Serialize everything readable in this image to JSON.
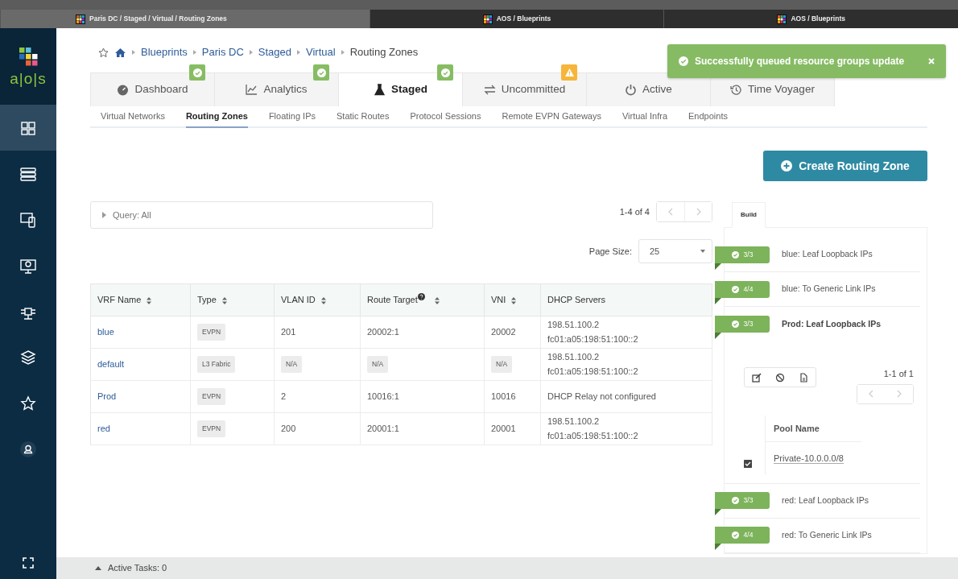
{
  "browser_tabs": [
    {
      "title": "Paris DC / Staged / Virtual / Routing Zones",
      "selected": true
    },
    {
      "title": "AOS / Blueprints",
      "selected": false
    },
    {
      "title": "AOS / Blueprints",
      "selected": false
    }
  ],
  "sidebar": {
    "logo": "a|o|s",
    "items": [
      {
        "kind": "blueprints",
        "selected": true
      },
      {
        "kind": "racks",
        "selected": false
      },
      {
        "kind": "devices",
        "selected": false
      },
      {
        "kind": "monitor",
        "selected": false
      },
      {
        "kind": "network",
        "selected": false
      },
      {
        "kind": "layers",
        "selected": false
      },
      {
        "kind": "star",
        "selected": false
      },
      {
        "kind": "user",
        "selected": false
      }
    ]
  },
  "breadcrumb": {
    "starred": false,
    "items": [
      "Blueprints",
      "Paris DC",
      "Staged",
      "Virtual",
      "Routing Zones"
    ]
  },
  "tabs": [
    {
      "label": "Dashboard",
      "kind": "gauge",
      "selected": false,
      "badge": {
        "kind": "ok"
      }
    },
    {
      "label": "Analytics",
      "kind": "chart",
      "selected": false,
      "badge": {
        "kind": "ok"
      }
    },
    {
      "label": "Staged",
      "kind": "flask",
      "selected": true,
      "badge": {
        "kind": "ok"
      }
    },
    {
      "label": "Uncommitted",
      "kind": "exchange",
      "selected": false,
      "badge": {
        "kind": "warning"
      }
    },
    {
      "label": "Active",
      "kind": "power",
      "selected": false
    },
    {
      "label": "Time Voyager",
      "kind": "history",
      "selected": false
    }
  ],
  "subtabs": [
    {
      "label": "Virtual Networks",
      "selected": false
    },
    {
      "label": "Routing Zones",
      "selected": true
    },
    {
      "label": "Floating IPs",
      "selected": false
    },
    {
      "label": "Static Routes",
      "selected": false
    },
    {
      "label": "Protocol Sessions",
      "selected": false
    },
    {
      "label": "Remote EVPN Gateways",
      "selected": false
    },
    {
      "label": "Virtual Infra",
      "selected": false
    },
    {
      "label": "Endpoints",
      "selected": false
    }
  ],
  "toast": {
    "kind": "success",
    "text": "Successfully queued resource groups update"
  },
  "create_button": "Create Routing Zone",
  "query": {
    "label": "Query: All"
  },
  "pagination": "1-4 of 4",
  "page_size": {
    "label": "Page Size:",
    "value": "25"
  },
  "table": {
    "columns": [
      {
        "label": "VRF Name",
        "sortable": true,
        "info": false
      },
      {
        "label": "Type",
        "sortable": true,
        "info": false
      },
      {
        "label": "VLAN ID",
        "sortable": true,
        "info": false
      },
      {
        "label": "Route Target",
        "sortable": true,
        "info": true
      },
      {
        "label": "VNI",
        "sortable": true,
        "info": false
      },
      {
        "label": "DHCP Servers",
        "sortable": false,
        "info": false
      }
    ],
    "rows": [
      {
        "cells": [
          {
            "kind": "link",
            "text": "blue"
          },
          {
            "kind": "tag",
            "text": "EVPN"
          },
          {
            "kind": "plain",
            "text": "201"
          },
          {
            "kind": "plain",
            "text": "20002:1"
          },
          {
            "kind": "plain",
            "text": "20002"
          },
          {
            "kind": "lines",
            "lines": [
              "198.51.100.2",
              "fc01:a05:198:51:100::2"
            ]
          }
        ]
      },
      {
        "cells": [
          {
            "kind": "link",
            "text": "default"
          },
          {
            "kind": "tag",
            "text": "L3 Fabric"
          },
          {
            "kind": "tag",
            "text": "N/A"
          },
          {
            "kind": "tag",
            "text": "N/A"
          },
          {
            "kind": "tag",
            "text": "N/A"
          },
          {
            "kind": "lines",
            "lines": [
              "198.51.100.2",
              "fc01:a05:198:51:100::2"
            ]
          }
        ]
      },
      {
        "cells": [
          {
            "kind": "link",
            "text": "Prod"
          },
          {
            "kind": "tag",
            "text": "EVPN"
          },
          {
            "kind": "plain",
            "text": "2"
          },
          {
            "kind": "plain",
            "text": "10016:1"
          },
          {
            "kind": "plain",
            "text": "10016"
          },
          {
            "kind": "plain",
            "text": "DHCP Relay not configured"
          }
        ]
      },
      {
        "cells": [
          {
            "kind": "link",
            "text": "red"
          },
          {
            "kind": "tag",
            "text": "EVPN"
          },
          {
            "kind": "plain",
            "text": "200"
          },
          {
            "kind": "plain",
            "text": "20001:1"
          },
          {
            "kind": "plain",
            "text": "20001"
          },
          {
            "kind": "lines",
            "lines": [
              "198.51.100.2",
              "fc01:a05:198:51:100::2"
            ]
          }
        ]
      }
    ]
  },
  "build": {
    "tab": "Build",
    "items": [
      {
        "count": "3/3",
        "label": "blue: Leaf Loopback IPs",
        "expanded": false
      },
      {
        "count": "4/4",
        "label": "blue: To Generic Link IPs",
        "expanded": false
      },
      {
        "count": "3/3",
        "label": "Prod: Leaf Loopback IPs",
        "expanded": true,
        "detail": {
          "pagination": "1-1 of 1",
          "column": "Pool Name",
          "pools": [
            {
              "name": "Private-10.0.0.0/8",
              "checked": true
            }
          ]
        }
      },
      {
        "count": "3/3",
        "label": "red: Leaf Loopback IPs",
        "expanded": false
      },
      {
        "count": "4/4",
        "label": "red: To Generic Link IPs",
        "expanded": false
      }
    ]
  },
  "status_bar": {
    "expanded": false,
    "text": "Active Tasks: 0"
  }
}
